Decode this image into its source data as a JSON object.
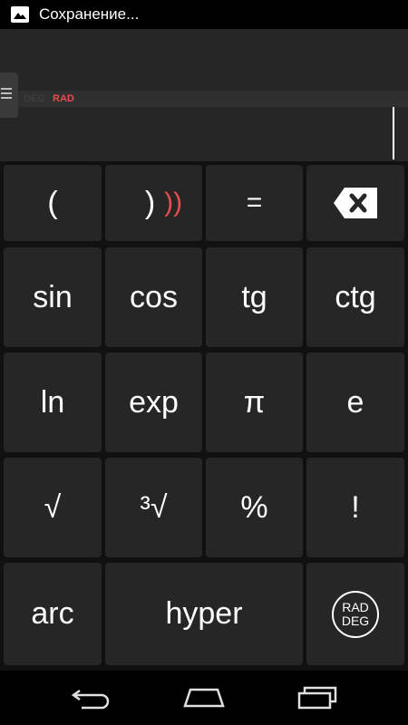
{
  "status_bar": {
    "icon": "image-icon",
    "text": "Сохранение..."
  },
  "display": {
    "mode_deg": "DEG",
    "mode_rad": "RAD"
  },
  "keys": {
    "open_paren": "(",
    "close_paren": ")",
    "close_paren_hint": "))",
    "equals": "=",
    "sin": "sin",
    "cos": "cos",
    "tg": "tg",
    "ctg": "ctg",
    "ln": "ln",
    "exp": "exp",
    "pi": "π",
    "e": "e",
    "sqrt": "√",
    "cbrt": "³√",
    "percent": "%",
    "factorial": "!",
    "arc": "arc",
    "hyper": "hyper",
    "rad": "RAD",
    "deg": "DEG"
  },
  "colors": {
    "accent": "#e84c4c",
    "key_bg": "#262626",
    "display_bg": "#262626"
  }
}
